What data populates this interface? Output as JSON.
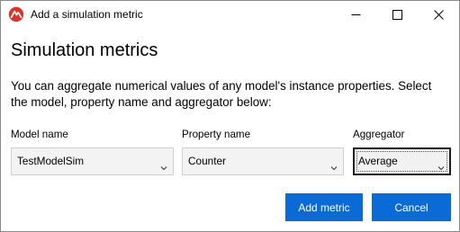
{
  "window": {
    "title": "Add a simulation metric",
    "controls": {
      "minimize": "minimize-icon",
      "maximize": "maximize-icon",
      "close": "close-icon"
    }
  },
  "dialog": {
    "heading": "Simulation metrics",
    "description": "You can aggregate numerical values of any model's instance properties. Select the model, property name and aggregator below:"
  },
  "fields": {
    "model": {
      "label": "Model name",
      "value": "TestModelSim"
    },
    "property": {
      "label": "Property name",
      "value": "Counter"
    },
    "aggregator": {
      "label": "Aggregator",
      "value": "Average"
    }
  },
  "buttons": {
    "add_label": "Add metric",
    "cancel_label": "Cancel"
  },
  "colors": {
    "accent": "#0a6bd6",
    "app_icon": "#d9362b"
  }
}
